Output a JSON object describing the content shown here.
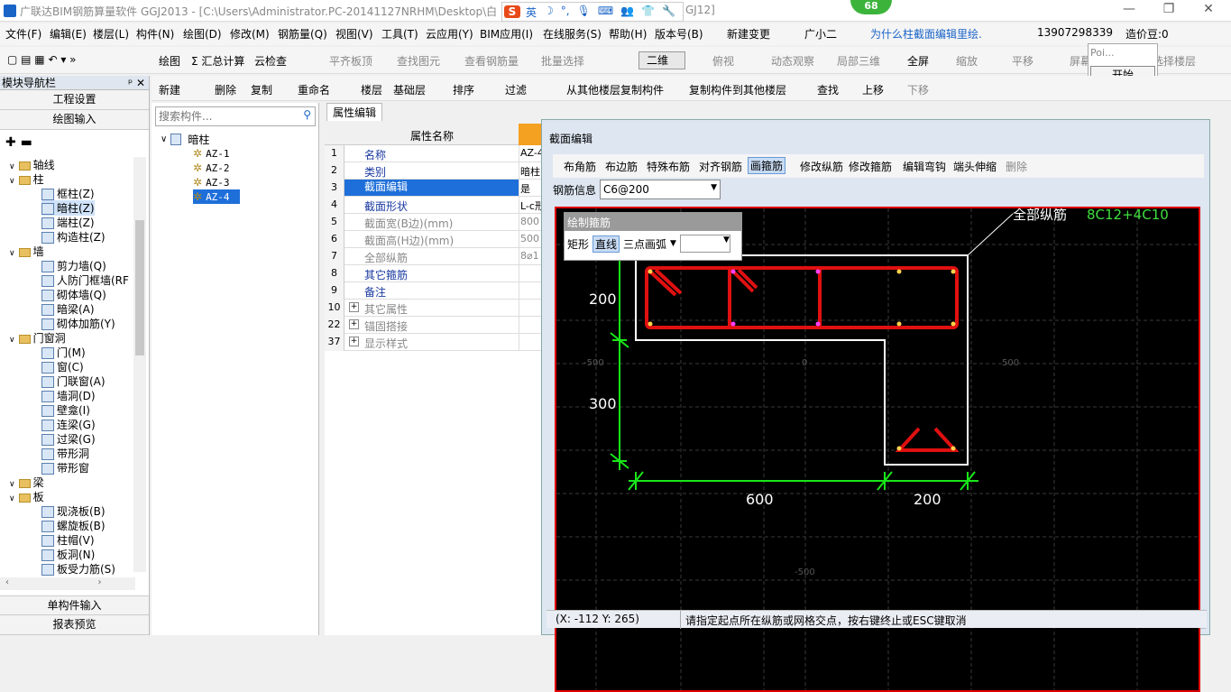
{
  "titlebar": {
    "title": "广联达BIM钢筋算量软件 GGJ2013 - [C:\\Users\\Administrator.PC-20141127NRHM\\Desktop\\白",
    "title_tail": "GJ12]",
    "btn_min": "—",
    "btn_max": "❐",
    "btn_close": "✕",
    "ime": {
      "logo": "S",
      "items": [
        "英",
        "☽",
        "°,",
        "🎙",
        "⌨",
        "👥",
        "👕",
        "🔧"
      ]
    }
  },
  "badge": "68",
  "menubar": [
    "文件(F)",
    "编辑(E)",
    "楼层(L)",
    "构件(N)",
    "绘图(D)",
    "修改(M)",
    "钢筋量(Q)",
    "视图(V)",
    "工具(T)",
    "云应用(Y)",
    "BIM应用(I)",
    "在线服务(S)",
    "帮助(H)",
    "版本号(B)",
    "新建变更",
    "广小二",
    "为什么柱截面编辑里绘.",
    "13907298339",
    "造价豆:0"
  ],
  "toolbar1": [
    "绘图",
    "Σ 汇总计算",
    "云检查",
    "平齐板顶",
    "查找图元",
    "查看钢筋量",
    "批量选择",
    "二维",
    "俯视",
    "动态观察",
    "局部三维",
    "全屏",
    "缩放",
    "平移",
    "屏幕旋转",
    "选择楼层"
  ],
  "popup": {
    "label": "Poi...",
    "button": "开始"
  },
  "leftpanel": {
    "title": "模块导航栏",
    "pin": "ᵖ ✕",
    "buttons": [
      "工程设置",
      "绘图输入"
    ],
    "bottom": [
      "单构件输入",
      "报表预览"
    ],
    "tree": [
      {
        "t": "轴线",
        "lv": 0,
        "f": true
      },
      {
        "t": "柱",
        "lv": 0,
        "f": true
      },
      {
        "t": "框柱(Z)",
        "lv": 1
      },
      {
        "t": "暗柱(Z)",
        "lv": 1,
        "sel": true
      },
      {
        "t": "端柱(Z)",
        "lv": 1
      },
      {
        "t": "构造柱(Z)",
        "lv": 1
      },
      {
        "t": "墙",
        "lv": 0,
        "f": true
      },
      {
        "t": "剪力墙(Q)",
        "lv": 1
      },
      {
        "t": "人防门框墙(RF",
        "lv": 1
      },
      {
        "t": "砌体墙(Q)",
        "lv": 1
      },
      {
        "t": "暗梁(A)",
        "lv": 1
      },
      {
        "t": "砌体加筋(Y)",
        "lv": 1
      },
      {
        "t": "门窗洞",
        "lv": 0,
        "f": true
      },
      {
        "t": "门(M)",
        "lv": 1
      },
      {
        "t": "窗(C)",
        "lv": 1
      },
      {
        "t": "门联窗(A)",
        "lv": 1
      },
      {
        "t": "墙洞(D)",
        "lv": 1
      },
      {
        "t": "壁龛(I)",
        "lv": 1
      },
      {
        "t": "连梁(G)",
        "lv": 1
      },
      {
        "t": "过梁(G)",
        "lv": 1
      },
      {
        "t": "带形洞",
        "lv": 1
      },
      {
        "t": "带形窗",
        "lv": 1
      },
      {
        "t": "梁",
        "lv": 0,
        "f": true
      },
      {
        "t": "板",
        "lv": 0,
        "f": true
      },
      {
        "t": "现浇板(B)",
        "lv": 1
      },
      {
        "t": "螺旋板(B)",
        "lv": 1
      },
      {
        "t": "柱帽(V)",
        "lv": 1
      },
      {
        "t": "板洞(N)",
        "lv": 1
      },
      {
        "t": "板受力筋(S)",
        "lv": 1
      }
    ]
  },
  "toolbar2": [
    "新建",
    "删除",
    "复制",
    "重命名",
    "楼层",
    "基础层",
    "排序",
    "过滤",
    "从其他楼层复制构件",
    "复制构件到其他楼层",
    "查找",
    "上移",
    "下移"
  ],
  "comptree": {
    "search": "搜索构件...",
    "root": "暗柱",
    "items": [
      "AZ-1",
      "AZ-2",
      "AZ-3",
      "AZ-4"
    ],
    "selected": 3
  },
  "prop": {
    "tab": "属性编辑",
    "header": "属性名称",
    "rows": [
      {
        "n": "1",
        "k": "名称",
        "v": "AZ-4",
        "g": false
      },
      {
        "n": "2",
        "k": "类别",
        "v": "暗柱",
        "g": false
      },
      {
        "n": "3",
        "k": "截面编辑",
        "v": "是",
        "g": false,
        "sel": true
      },
      {
        "n": "4",
        "k": "截面形状",
        "v": "L-c形",
        "g": false
      },
      {
        "n": "5",
        "k": "截面宽(B边)(mm)",
        "v": "800",
        "g": true
      },
      {
        "n": "6",
        "k": "截面高(H边)(mm)",
        "v": "500",
        "g": true
      },
      {
        "n": "7",
        "k": "全部纵筋",
        "v": "8⌀1",
        "g": true
      },
      {
        "n": "8",
        "k": "其它箍筋",
        "v": "",
        "g": false
      },
      {
        "n": "9",
        "k": "备注",
        "v": "",
        "g": false
      },
      {
        "n": "10",
        "k": "其它属性",
        "v": "",
        "g": true,
        "plus": true
      },
      {
        "n": "22",
        "k": "锚固搭接",
        "v": "",
        "g": true,
        "plus": true
      },
      {
        "n": "37",
        "k": "显示样式",
        "v": "",
        "g": true,
        "plus": true
      }
    ]
  },
  "dialog": {
    "title": "截面编辑",
    "tools": [
      "布角筋",
      "布边筋",
      "特殊布筋",
      "对齐钢筋",
      "画箍筋",
      "修改纵筋",
      "修改箍筋",
      "编辑弯钩",
      "端头伸缩",
      "删除"
    ],
    "rebar_label": "钢筋信息",
    "rebar_value": "C6@200",
    "subpanel": {
      "title": "绘制箍筋",
      "items": [
        "矩形",
        "直线",
        "三点画弧"
      ]
    },
    "annot": "全部纵筋",
    "annot_val": "8C12+4C10",
    "dims": {
      "d200v": "200",
      "d300v": "300",
      "d600": "600",
      "d200h": "200"
    },
    "axis": {
      "xneg": "-500",
      "x0": "0",
      "xpos": "500",
      "yneg": "-500"
    },
    "status_coord": "(X: -112 Y: 265)",
    "status_msg": "请指定起点所在纵筋或网格交点，按右键终止或ESC键取消"
  },
  "colors": {
    "rebar": "#e01010",
    "dim": "#19e619",
    "annot": "#3fe03f"
  }
}
